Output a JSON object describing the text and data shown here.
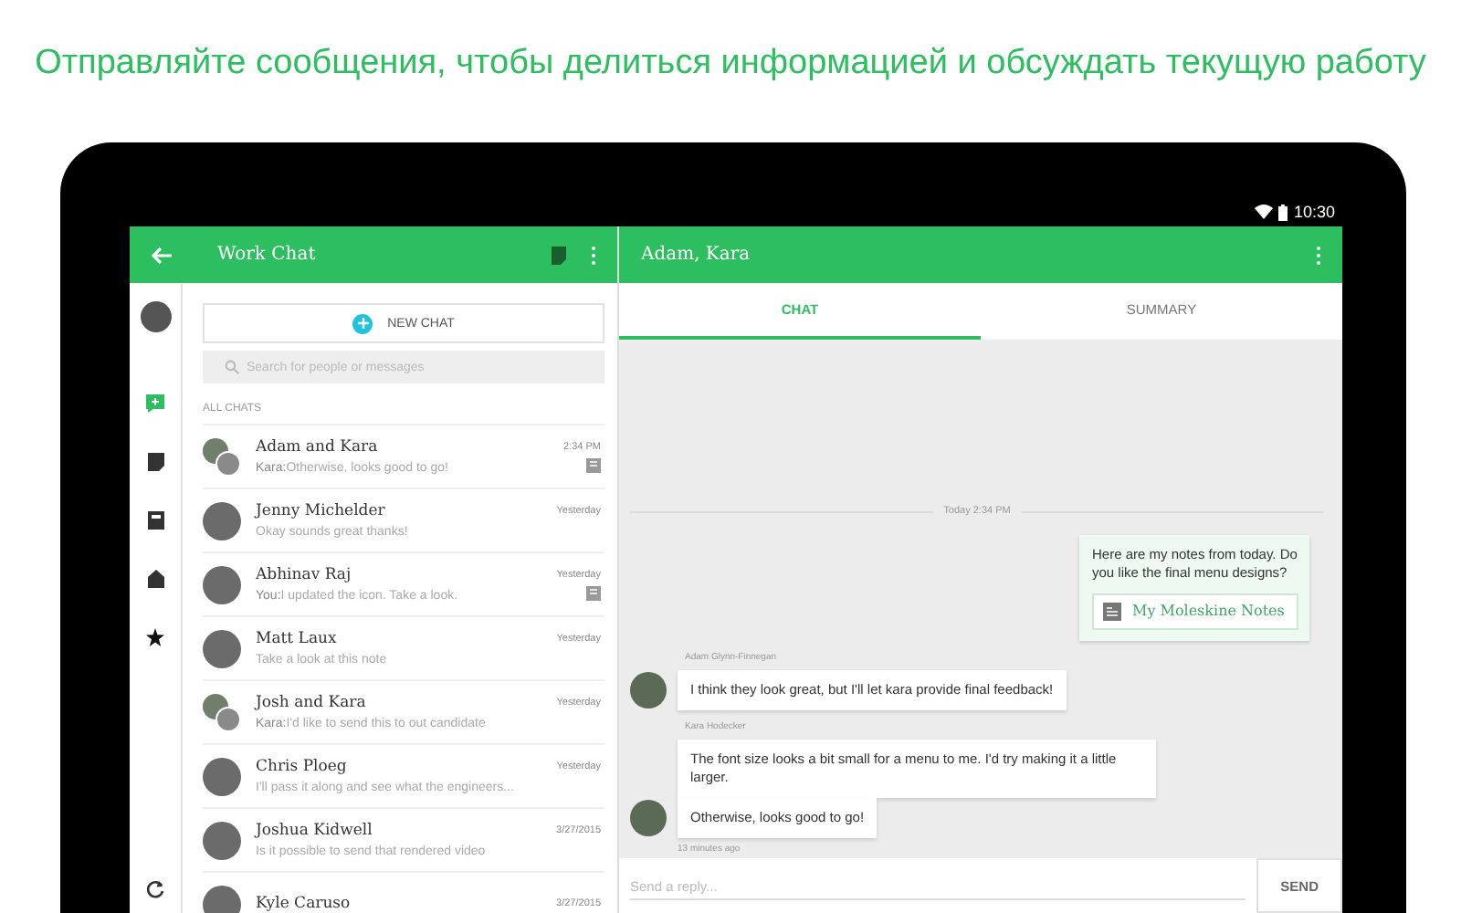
{
  "headline": "Отправляйте сообщения, чтобы делиться информацией и обсуждать текущую работу",
  "status_bar": {
    "time": "10:30"
  },
  "left_pane": {
    "title": "Work Chat",
    "rail": [
      {
        "kind": "avatar",
        "selected": false
      },
      {
        "kind": "chat",
        "selected": true
      },
      {
        "kind": "note",
        "selected": false
      },
      {
        "kind": "notebook",
        "selected": false
      },
      {
        "kind": "shared",
        "selected": false
      },
      {
        "kind": "star",
        "selected": false
      }
    ],
    "new_chat": "NEW CHAT",
    "search": {
      "placeholder": "Search for people or messages"
    },
    "section": "ALL CHATS",
    "chats": [
      {
        "name": "Adam and Kara",
        "sender": "Kara:",
        "preview": "Otherwise, looks good to go!",
        "time": "2:34 PM",
        "note": true,
        "group": true
      },
      {
        "name": "Jenny Michelder",
        "preview": "Okay sounds great thanks!",
        "time": "Yesterday",
        "note": false,
        "group": false
      },
      {
        "name": "Abhinav Raj",
        "sender": "You:",
        "preview": "I updated the icon. Take a look.",
        "time": "Yesterday",
        "note": true,
        "group": false
      },
      {
        "name": "Matt Laux",
        "preview": "Take a look at this note",
        "time": "Yesterday",
        "note": false,
        "group": false
      },
      {
        "name": "Josh and Kara",
        "sender": "Kara:",
        "preview": "I'd like to send this to out candidate",
        "time": "Yesterday",
        "note": false,
        "group": true
      },
      {
        "name": "Chris Ploeg",
        "preview": "I'll pass it along and see what the engineers...",
        "time": "Yesterday",
        "note": false,
        "group": false
      },
      {
        "name": "Joshua Kidwell",
        "preview": "Is it possible to send that rendered video",
        "time": "3/27/2015",
        "note": false,
        "group": false
      },
      {
        "name": "Kyle Caruso",
        "time": "3/27/2015",
        "group": false
      }
    ]
  },
  "right_pane": {
    "title": "Adam, Kara",
    "tabs": [
      {
        "label": "CHAT",
        "selected": true
      },
      {
        "label": "SUMMARY",
        "selected": false
      }
    ],
    "date_divider": "Today 2:34 PM",
    "messages": [
      {
        "kind": "outgoing",
        "text": "Here  are my notes from today. Do you like the final menu designs?",
        "attachment": "My Moleskine Notes"
      },
      {
        "kind": "incoming",
        "sender": "Adam Glynn-Finnegan",
        "text": "I think they look great, but I'll let kara provide final feedback!",
        "avatar": true
      },
      {
        "kind": "incoming",
        "sender": "Kara Hodecker",
        "text": "The font size looks a bit small for a menu to me. I'd try making it a little larger.",
        "avatar": false
      },
      {
        "kind": "incoming",
        "text": "Otherwise, looks good to go!",
        "avatar": true,
        "time": "13 minutes ago"
      }
    ],
    "reply": {
      "placeholder": "Send a reply..."
    },
    "send": "SEND"
  }
}
